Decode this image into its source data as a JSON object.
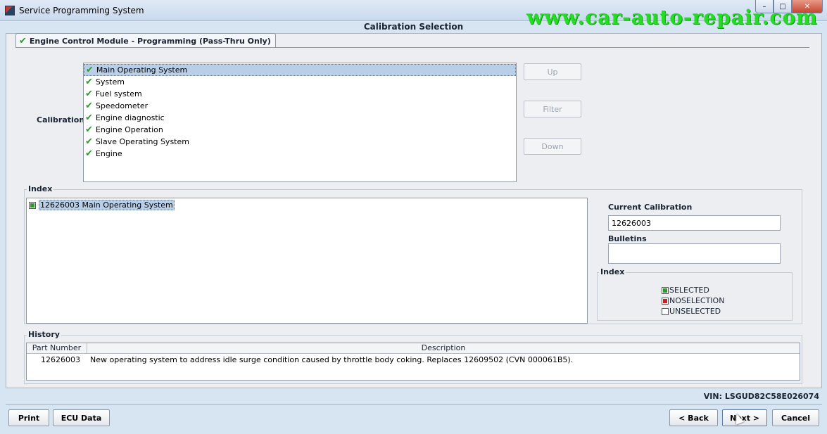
{
  "window": {
    "title": "Service Programming System",
    "watermark": "www.car-auto-repair.com"
  },
  "page_title": "Calibration Selection",
  "tab": {
    "label": "Engine Control Module - Programming (Pass-Thru Only)"
  },
  "calibration": {
    "label": "Calibration",
    "items": [
      {
        "label": "Main Operating System"
      },
      {
        "label": "System"
      },
      {
        "label": "Fuel system"
      },
      {
        "label": "Speedometer"
      },
      {
        "label": "Engine diagnostic"
      },
      {
        "label": "Engine Operation"
      },
      {
        "label": "Slave Operating System"
      },
      {
        "label": "Engine"
      }
    ],
    "buttons": {
      "up": "Up",
      "filter": "Filter",
      "down": "Down"
    }
  },
  "index": {
    "title": "Index",
    "items": [
      {
        "label": "12626003 Main Operating System"
      }
    ]
  },
  "current_calibration": {
    "label": "Current Calibration",
    "value": "12626003"
  },
  "bulletins": {
    "label": "Bulletins",
    "value": ""
  },
  "legend": {
    "title": "Index",
    "selected": "SELECTED",
    "noselection": "NOSELECTION",
    "unselected": "UNSELECTED"
  },
  "history": {
    "title": "History",
    "columns": [
      "Part Number",
      "Description"
    ],
    "rows": [
      {
        "part_number": "12626003",
        "description": "New operating system to address idle surge condition caused by throttle body coking. Replaces 12609502 (CVN 000061B5)."
      }
    ]
  },
  "vin": "VIN: LSGUD82C58E026074",
  "footer": {
    "print": "Print",
    "ecu_data": "ECU Data",
    "back": "< Back",
    "next": "Next >",
    "cancel": "Cancel"
  },
  "colors": {
    "check_green": "#2d9a2d",
    "selection": "#b9cfe8",
    "noselection_red": "#c62222"
  }
}
